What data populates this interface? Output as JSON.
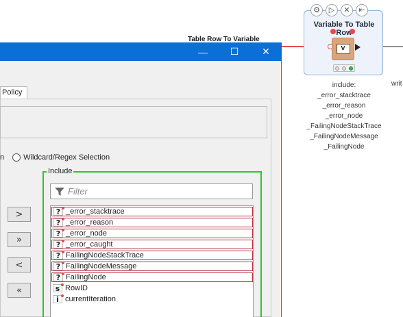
{
  "node": {
    "title": "Variable To Table Row",
    "background_title": "Table Row To Variable",
    "actions": [
      {
        "icon": "gear-icon",
        "glyph": "⚙"
      },
      {
        "icon": "play-icon",
        "glyph": "▷"
      },
      {
        "icon": "cancel-icon",
        "glyph": "✕"
      },
      {
        "icon": "reset-icon",
        "glyph": "⇤"
      }
    ],
    "icon_glyph": "V",
    "annotation": [
      "include:",
      "_error_stacktrace",
      "_error_reason",
      "_error_node",
      "_FailingNodeStackTrace",
      "_FailingNodeMessage",
      "_FailingNode"
    ],
    "next_node_partial": "writ"
  },
  "dialog": {
    "minimize_glyph": "—",
    "maximize_glyph": "☐",
    "close_glyph": "✕",
    "tab_label": "Policy",
    "radio_partial": "n",
    "radio_label": "Wildcard/Regex Selection",
    "include_legend": "Include",
    "filter_placeholder": "Filter",
    "buttons": [
      ">",
      "»",
      "<",
      "«"
    ],
    "include_items": [
      {
        "type": "?",
        "name": "_error_stacktrace",
        "flow": true
      },
      {
        "type": "?",
        "name": "_error_reason",
        "flow": true
      },
      {
        "type": "?",
        "name": "_error_node",
        "flow": true
      },
      {
        "type": "?",
        "name": "_error_caught",
        "flow": true
      },
      {
        "type": "?",
        "name": "FailingNodeStackTrace",
        "flow": true
      },
      {
        "type": "?",
        "name": "FailingNodeMessage",
        "flow": true
      },
      {
        "type": "?",
        "name": "FailingNode",
        "flow": true
      },
      {
        "type": "s",
        "name": "RowID",
        "flow": true
      },
      {
        "type": "i",
        "name": "currentIteration",
        "flow": true
      }
    ]
  },
  "colors": {
    "accent": "#0a6fd6",
    "error_border": "#b52f3a",
    "include_border": "#2fc42f",
    "flow_var": "#e8494f"
  }
}
